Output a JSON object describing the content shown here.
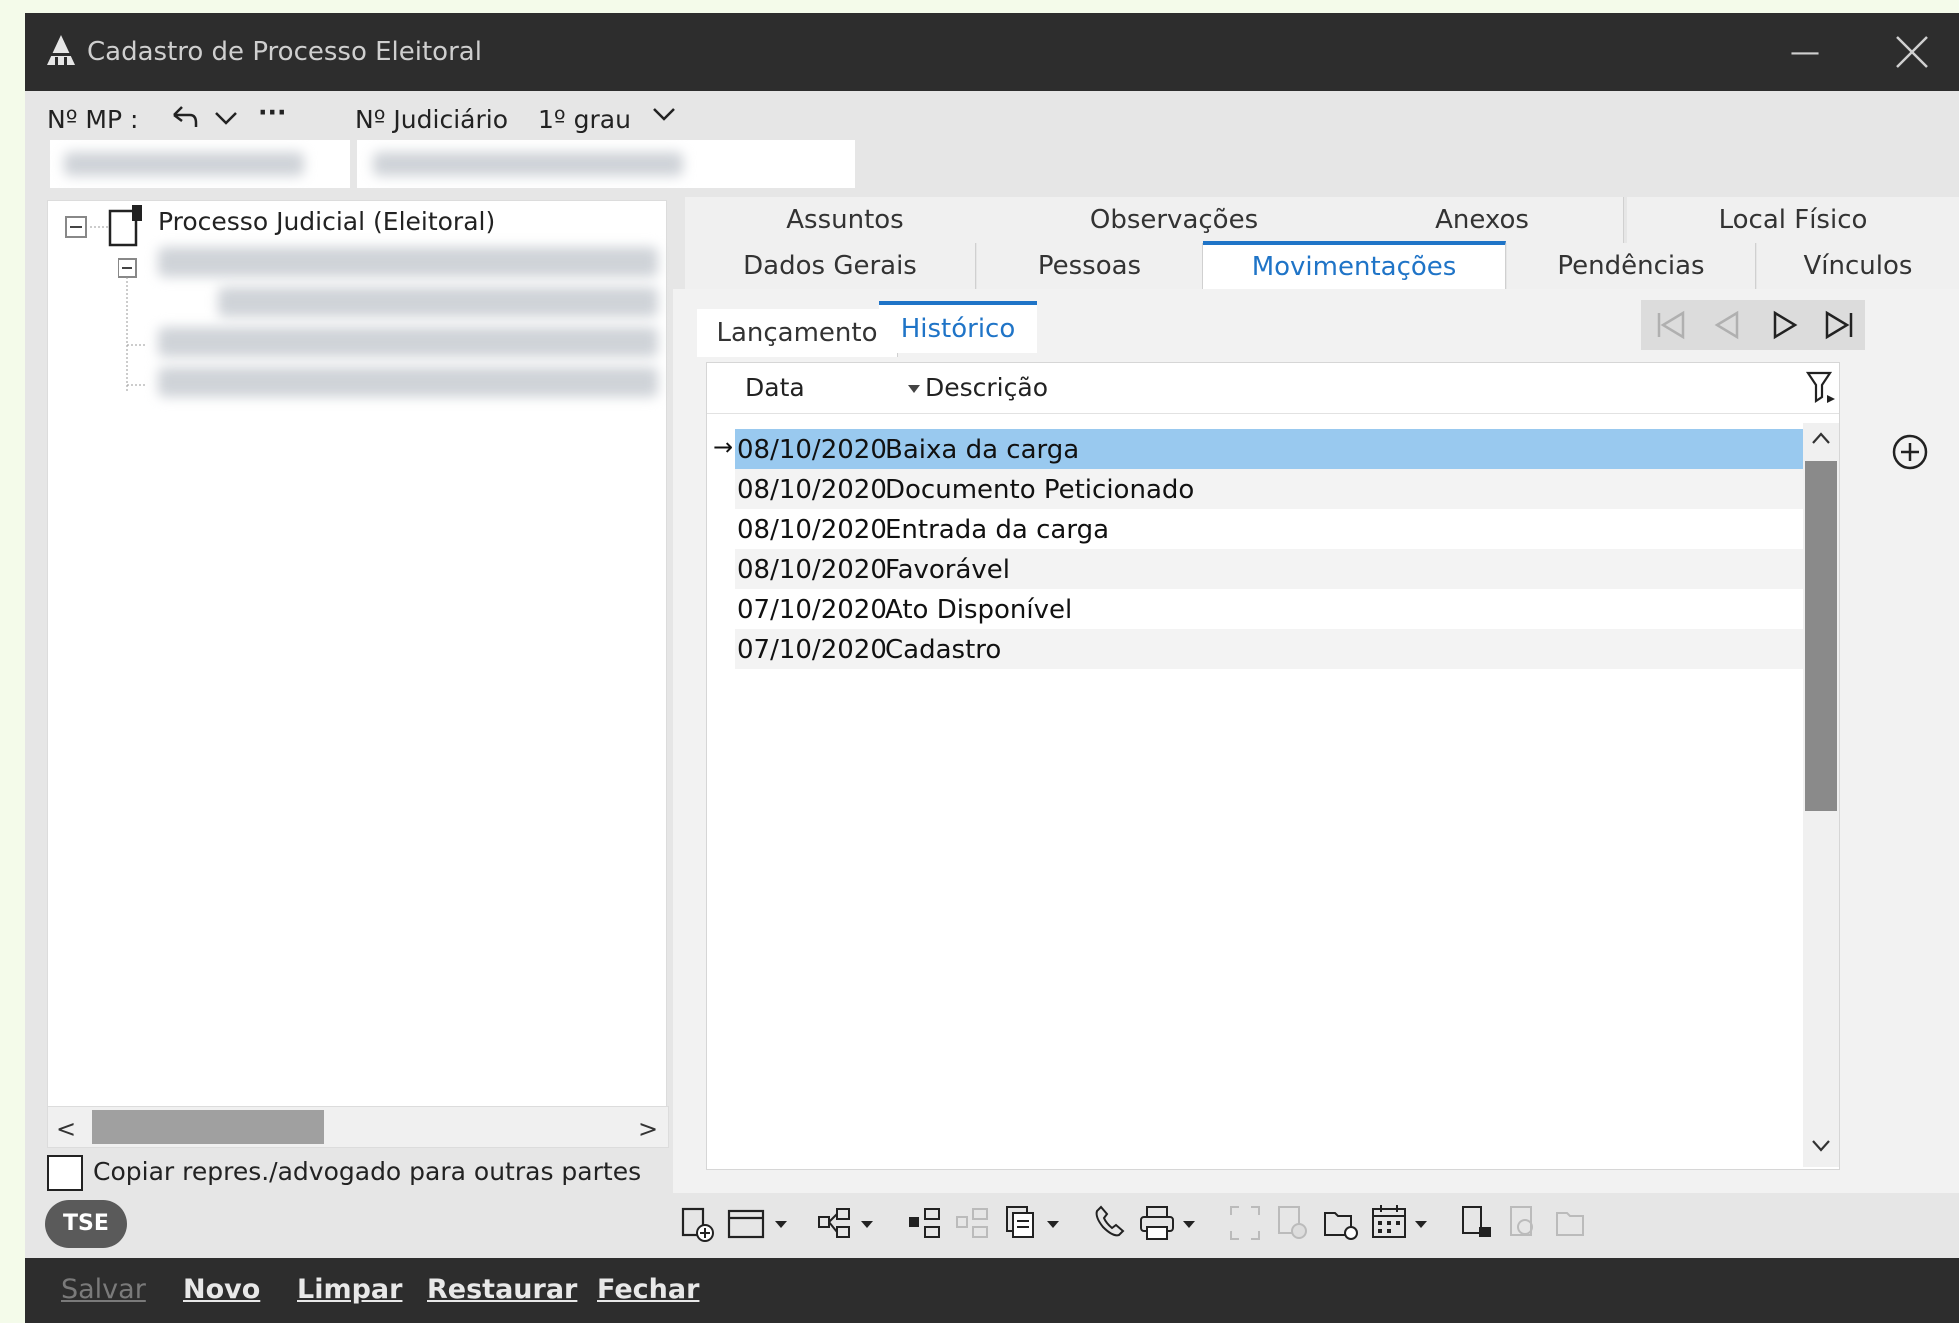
{
  "window": {
    "title": "Cadastro de Processo Eleitoral"
  },
  "header": {
    "mp_label": "Nº MP :",
    "judiciario_label": "Nº Judiciário",
    "grau_label": "1º grau"
  },
  "tree": {
    "root_label": "Processo Judicial (Eleitoral)"
  },
  "tabs_top": [
    "Assuntos",
    "Observações",
    "Anexos",
    "Local Físico"
  ],
  "tabs_second": [
    "Dados Gerais",
    "Pessoas",
    "Movimentações",
    "Pendências",
    "Vínculos"
  ],
  "subtabs": [
    "Lançamento",
    "Histórico"
  ],
  "grid": {
    "col_data": "Data",
    "col_desc": "Descrição",
    "rows": [
      {
        "data": "08/10/2020",
        "desc": "Baixa da carga"
      },
      {
        "data": "08/10/2020",
        "desc": "Documento Peticionado"
      },
      {
        "data": "08/10/2020",
        "desc": "Entrada da carga"
      },
      {
        "data": "08/10/2020",
        "desc": "Favorável"
      },
      {
        "data": "07/10/2020",
        "desc": "Ato Disponível"
      },
      {
        "data": "07/10/2020",
        "desc": "Cadastro"
      }
    ]
  },
  "checkbox_label": "Copiar repres./advogado para outras partes",
  "badge": "TSE",
  "footer": {
    "salvar": "Salvar",
    "novo": "Novo",
    "limpar": "Limpar",
    "restaurar": "Restaurar",
    "fechar": "Fechar"
  },
  "colors": {
    "accent": "#1f74c7",
    "selected_row": "#99c9ef",
    "titlebar": "#2d2d2d"
  }
}
